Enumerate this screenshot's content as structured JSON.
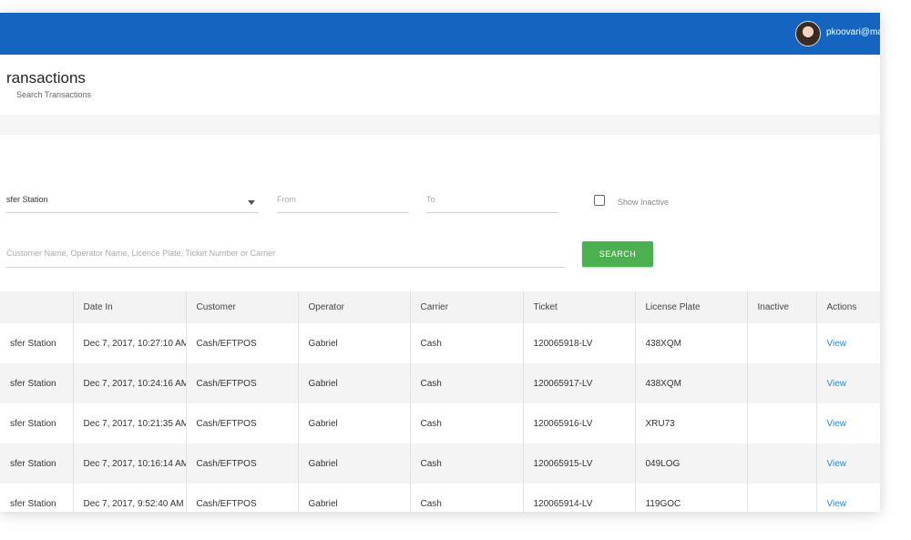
{
  "header": {
    "user": "pkoovari@ma",
    "page_title": "ransactions",
    "breadcrumb": "Search Transactions"
  },
  "filters": {
    "station_value": "sfer Station",
    "from_placeholder": "From",
    "to_placeholder": "To",
    "show_inactive_label": "Show Inactive",
    "show_inactive_checked": false,
    "search_placeholder": "Customer Name, Operator Name, Licence Plate, Ticket Number or Carrier",
    "search_button": "SEARCH"
  },
  "colors": {
    "appbar": "#1565c0",
    "search_button": "#4caf50",
    "link": "#1e88e5"
  },
  "table": {
    "columns": [
      "",
      "Date In",
      "Customer",
      "Operator",
      "Carrier",
      "Ticket",
      "License Plate",
      "Inactive",
      "Actions"
    ],
    "rows": [
      {
        "station": "sfer Station",
        "date": "Dec 7, 2017, 10:27:10 AM",
        "customer": "Cash/EFTPOS",
        "operator": "Gabriel",
        "carrier": "Cash",
        "ticket": "120065918-LV",
        "plate": "438XQM",
        "inactive": "",
        "action": "View"
      },
      {
        "station": "sfer Station",
        "date": "Dec 7, 2017, 10:24:16 AM",
        "customer": "Cash/EFTPOS",
        "operator": "Gabriel",
        "carrier": "Cash",
        "ticket": "120065917-LV",
        "plate": "438XQM",
        "inactive": "",
        "action": "View"
      },
      {
        "station": "sfer Station",
        "date": "Dec 7, 2017, 10:21:35 AM",
        "customer": "Cash/EFTPOS",
        "operator": "Gabriel",
        "carrier": "Cash",
        "ticket": "120065916-LV",
        "plate": "XRU73",
        "inactive": "",
        "action": "View"
      },
      {
        "station": "sfer Station",
        "date": "Dec 7, 2017, 10:16:14 AM",
        "customer": "Cash/EFTPOS",
        "operator": "Gabriel",
        "carrier": "Cash",
        "ticket": "120065915-LV",
        "plate": "049LOG",
        "inactive": "",
        "action": "View"
      },
      {
        "station": "sfer Station",
        "date": "Dec 7, 2017, 9:52:40 AM",
        "customer": "Cash/EFTPOS",
        "operator": "Gabriel",
        "carrier": "Cash",
        "ticket": "120065914-LV",
        "plate": "119GOC",
        "inactive": "",
        "action": "View"
      }
    ]
  }
}
